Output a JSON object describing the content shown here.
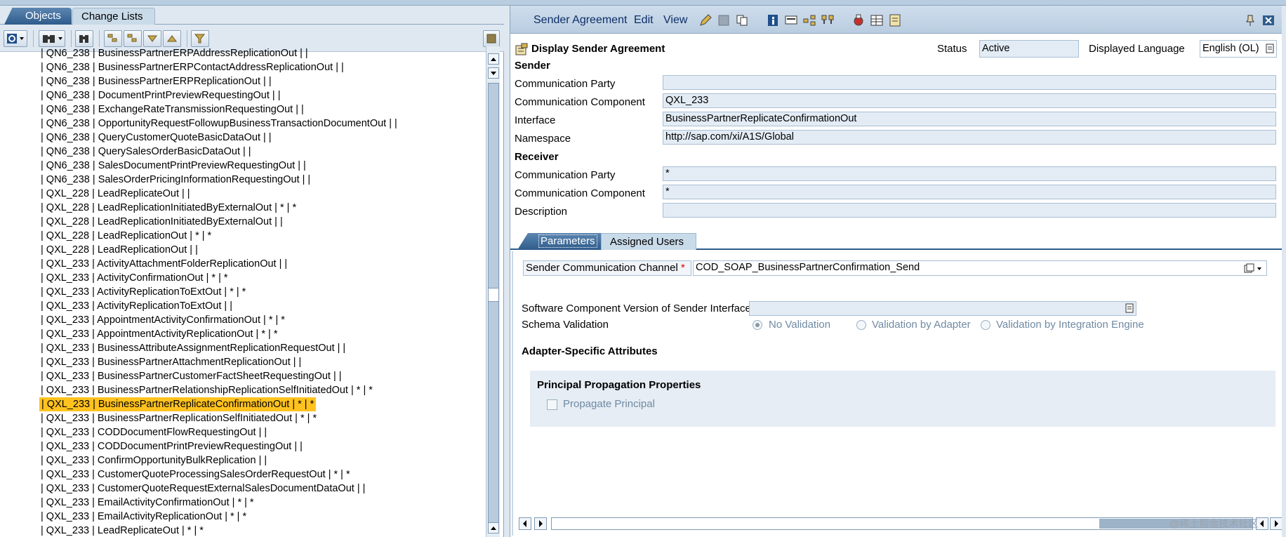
{
  "left_tabs": {
    "objects": "Objects",
    "change_lists": "Change Lists"
  },
  "tree_rows": [
    "| QN6_238 | BusinessPartnerERPAddressReplicationOut | |",
    "| QN6_238 | BusinessPartnerERPContactAddressReplicationOut | |",
    "| QN6_238 | BusinessPartnerERPReplicationOut | |",
    "| QN6_238 | DocumentPrintPreviewRequestingOut | |",
    "| QN6_238 | ExchangeRateTransmissionRequestingOut | |",
    "| QN6_238 | OpportunityRequestFollowupBusinessTransactionDocumentOut | |",
    "| QN6_238 | QueryCustomerQuoteBasicDataOut | |",
    "| QN6_238 | QuerySalesOrderBasicDataOut | |",
    "| QN6_238 | SalesDocumentPrintPreviewRequestingOut | |",
    "| QN6_238 | SalesOrderPricingInformationRequestingOut | |",
    "| QXL_228 | LeadReplicateOut | |",
    "| QXL_228 | LeadReplicationInitiatedByExternalOut | * | *",
    "| QXL_228 | LeadReplicationInitiatedByExternalOut | |",
    "| QXL_228 | LeadReplicationOut | * | *",
    "| QXL_228 | LeadReplicationOut | |",
    "| QXL_233 | ActivityAttachmentFolderReplicationOut | |",
    "| QXL_233 | ActivityConfirmationOut | * | *",
    "| QXL_233 | ActivityReplicationToExtOut | * | *",
    "| QXL_233 | ActivityReplicationToExtOut | |",
    "| QXL_233 | AppointmentActivityConfirmationOut | * | *",
    "| QXL_233 | AppointmentActivityReplicationOut | * | *",
    "| QXL_233 | BusinessAttributeAssignmentReplicationRequestOut | |",
    "| QXL_233 | BusinessPartnerAttachmentReplicationOut | |",
    "| QXL_233 | BusinessPartnerCustomerFactSheetRequestingOut | |",
    "| QXL_233 | BusinessPartnerRelationshipReplicationSelfInitiatedOut | * | *",
    "| QXL_233 | BusinessPartnerReplicateConfirmationOut | * | *",
    "| QXL_233 | BusinessPartnerReplicationSelfInitiatedOut | * | *",
    "| QXL_233 | CODDocumentFlowRequestingOut | |",
    "| QXL_233 | CODDocumentPrintPreviewRequestingOut | |",
    "| QXL_233 | ConfirmOpportunityBulkReplication | |",
    "| QXL_233 | CustomerQuoteProcessingSalesOrderRequestOut | * | *",
    "| QXL_233 | CustomerQuoteRequestExternalSalesDocumentDataOut | |",
    "| QXL_233 | EmailActivityConfirmationOut | * | *",
    "| QXL_233 | EmailActivityReplicationOut | * | *",
    "| QXL_233 | LeadReplicateOut | * | *"
  ],
  "selected_row_index": 25,
  "menu": {
    "sender_agreement": "Sender Agreement",
    "edit": "Edit",
    "view": "View"
  },
  "header": {
    "title": "Display Sender Agreement",
    "status_label": "Status",
    "status_value": "Active",
    "language_label": "Displayed Language",
    "language_value": "English (OL)"
  },
  "sender": {
    "heading": "Sender",
    "party_label": "Communication Party",
    "party_value": "",
    "component_label": "Communication Component",
    "component_value": "QXL_233",
    "interface_label": "Interface",
    "interface_value": "BusinessPartnerReplicateConfirmationOut",
    "namespace_label": "Namespace",
    "namespace_value": "http://sap.com/xi/A1S/Global"
  },
  "receiver": {
    "heading": "Receiver",
    "party_label": "Communication Party",
    "party_value": "*",
    "component_label": "Communication Component",
    "component_value": "*",
    "description_label": "Description",
    "description_value": ""
  },
  "tabs": {
    "parameters": "Parameters",
    "assigned_users": "Assigned Users"
  },
  "params": {
    "channel_label": "Sender Communication Channel",
    "required_mark": "*",
    "channel_value": "COD_SOAP_BusinessPartnerConfirmation_Send",
    "swcv_label": "Software Component Version of Sender Interface",
    "swcv_value": "",
    "schema_label": "Schema Validation",
    "schema_options": [
      "No Validation",
      "Validation by Adapter",
      "Validation by Integration Engine"
    ],
    "schema_selected": "No Validation",
    "adapter_heading": "Adapter-Specific Attributes",
    "principal_heading": "Principal Propagation Properties",
    "propagate_label": "Propagate Principal",
    "propagate_checked": false
  },
  "watermark": "@稀土掘金技术社区"
}
